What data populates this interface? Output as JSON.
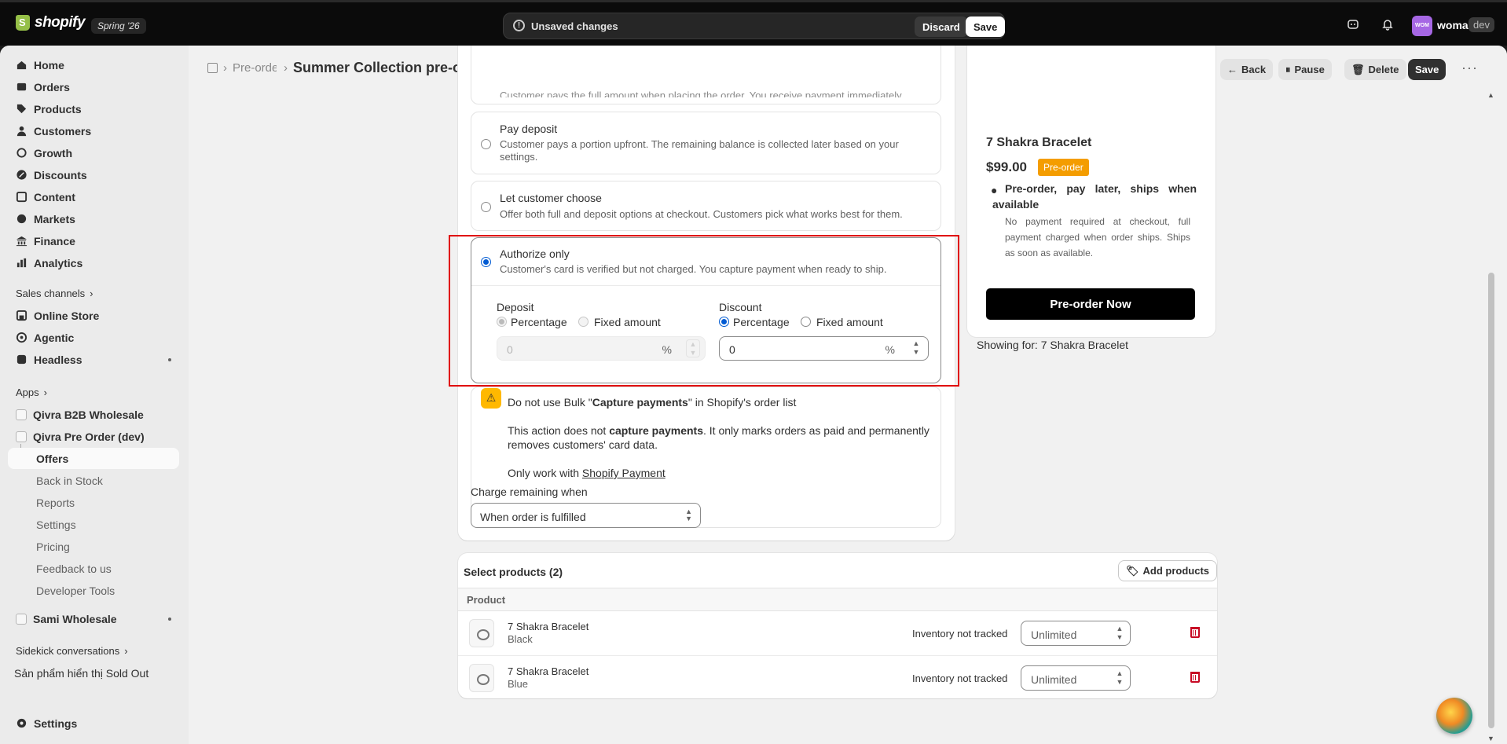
{
  "topbar": {
    "brand": "shopify",
    "edition": "Spring '26",
    "unsaved_text": "Unsaved changes",
    "discard_label": "Discard",
    "save_label": "Save",
    "avatar_initials": "WOM",
    "user_name": "woma",
    "user_badge": "dev"
  },
  "sidebar": {
    "main_items": [
      "Home",
      "Orders",
      "Products",
      "Customers",
      "Growth",
      "Discounts",
      "Content",
      "Markets",
      "Finance",
      "Analytics"
    ],
    "sales_channels_label": "Sales channels",
    "channels": [
      "Online Store",
      "Agentic",
      "Headless"
    ],
    "apps_label": "Apps",
    "apps": [
      "Qivra B2B Wholesale",
      "Qivra Pre Order (dev)"
    ],
    "app_subitems": [
      "Offers",
      "Back in Stock",
      "Reports",
      "Settings",
      "Pricing",
      "Feedback to us",
      "Developer Tools"
    ],
    "other_app": "Sami Wholesale",
    "sidekick_label": "Sidekick conversations",
    "sold_out_label": "Sản phẩm hiển thị Sold Out",
    "settings_label": "Settings"
  },
  "header": {
    "breadcrumb": "Pre-order",
    "title": "Summer Collection pre-order",
    "back_label": "Back",
    "pause_label": "Pause",
    "delete_label": "Delete",
    "save_label": "Save"
  },
  "payment": {
    "full_desc_partial": "Customer pays the full amount when placing the order. You receive payment immediately.",
    "deposit_title": "Pay deposit",
    "deposit_desc": "Customer pays a portion upfront. The remaining balance is collected later based on your settings.",
    "choose_title": "Let customer choose",
    "choose_desc": "Offer both full and deposit options at checkout. Customers pick what works best for them.",
    "auth_title": "Authorize only",
    "auth_desc": "Customer's card is verified but not charged. You capture payment when ready to ship.",
    "deposit_label": "Deposit",
    "discount_label": "Discount",
    "percentage_label": "Percentage",
    "fixed_label": "Fixed amount",
    "deposit_value": "0",
    "discount_value": "0",
    "unit": "%"
  },
  "warning": {
    "title_prefix": "Do not use Bulk \"",
    "title_bold": "Capture payments",
    "title_suffix": "\" in Shopify's order list",
    "body_prefix": "This action does not ",
    "body_bold": "capture payments",
    "body_suffix": ". It only marks orders as paid and permanently",
    "body_line2": "removes customers' card data.",
    "only_prefix": "Only work with ",
    "only_link": "Shopify Payment"
  },
  "charge": {
    "label": "Charge remaining when",
    "value": "When order is fulfilled"
  },
  "products": {
    "title": "Select products (2)",
    "add_label": "Add products",
    "column_product": "Product",
    "rows": [
      {
        "name": "7 Shakra Bracelet",
        "variant": "Black",
        "inventory": "Inventory not tracked",
        "qty": "Unlimited"
      },
      {
        "name": "7 Shakra Bracelet",
        "variant": "Blue",
        "inventory": "Inventory not tracked",
        "qty": "Unlimited"
      }
    ]
  },
  "preview": {
    "product_title": "7 Shakra Bracelet",
    "price": "$99.00",
    "badge": "Pre-order",
    "bullet": "Pre-order, pay later, ships when available",
    "note": "No payment required at checkout, full payment charged when order ships. Ships as soon as available.",
    "button": "Pre-order Now",
    "showing_for": "Showing for: 7 Shakra Bracelet"
  },
  "colors": {
    "accent": "#005bd3",
    "highlight": "#e00000",
    "badge": "#f49d00",
    "danger": "#c70a24"
  }
}
